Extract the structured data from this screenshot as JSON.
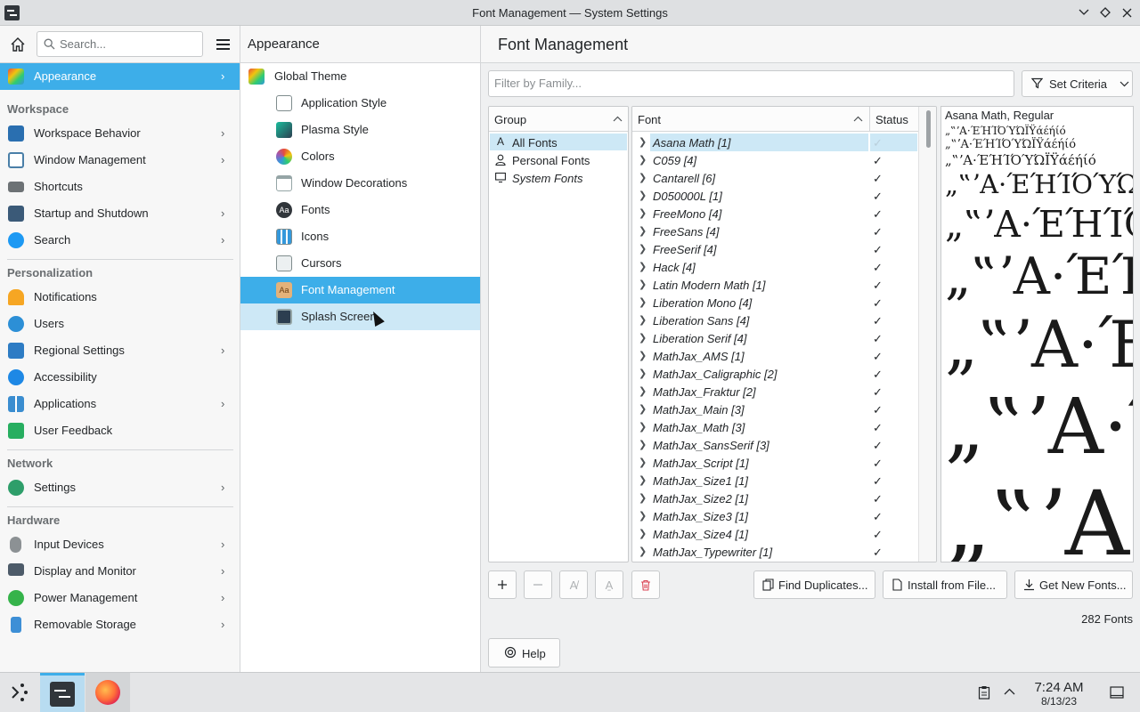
{
  "window": {
    "title": "Font Management — System Settings"
  },
  "sidebar": {
    "search_placeholder": "Search...",
    "selected": {
      "label": "Appearance"
    },
    "sections": {
      "workspace": "Workspace",
      "personalization": "Personalization",
      "network": "Network",
      "hardware": "Hardware"
    },
    "items": [
      {
        "label": "Workspace Behavior",
        "chevron": true,
        "color": "#2a6fb0"
      },
      {
        "label": "Window Management",
        "chevron": true,
        "color": "#4a7fa8"
      },
      {
        "label": "Shortcuts",
        "chevron": false,
        "color": "#6d7275"
      },
      {
        "label": "Startup and Shutdown",
        "chevron": true,
        "color": "#3b5a78"
      },
      {
        "label": "Search",
        "chevron": true,
        "color": "#1d99f3"
      },
      {
        "label": "Notifications",
        "chevron": false,
        "color": "#f6a623"
      },
      {
        "label": "Users",
        "chevron": false,
        "color": "#2c8fd6"
      },
      {
        "label": "Regional Settings",
        "chevron": true,
        "color": "#2d7cc4"
      },
      {
        "label": "Accessibility",
        "chevron": false,
        "color": "#1e88e5"
      },
      {
        "label": "Applications",
        "chevron": true,
        "color": "#3a8dd0"
      },
      {
        "label": "User Feedback",
        "chevron": false,
        "color": "#27ae60"
      },
      {
        "label": "Settings",
        "chevron": true,
        "color": "#2e9e6a"
      },
      {
        "label": "Input Devices",
        "chevron": true,
        "color": "#8c9194"
      },
      {
        "label": "Display and Monitor",
        "chevron": true,
        "color": "#4d5b69"
      },
      {
        "label": "Power Management",
        "chevron": true,
        "color": "#35b34a"
      },
      {
        "label": "Removable Storage",
        "chevron": true,
        "color": "#3d8fd6"
      }
    ]
  },
  "middle": {
    "title": "Appearance",
    "items": [
      {
        "label": "Global Theme"
      },
      {
        "label": "Application Style"
      },
      {
        "label": "Plasma Style"
      },
      {
        "label": "Colors"
      },
      {
        "label": "Window Decorations"
      },
      {
        "label": "Fonts"
      },
      {
        "label": "Icons"
      },
      {
        "label": "Cursors"
      },
      {
        "label": "Font Management"
      },
      {
        "label": "Splash Screen"
      }
    ]
  },
  "main": {
    "title": "Font Management",
    "filter_placeholder": "Filter by Family...",
    "criteria_label": "Set Criteria",
    "group_header": "Group",
    "groups": [
      {
        "label": "All Fonts"
      },
      {
        "label": "Personal Fonts"
      },
      {
        "label": "System Fonts"
      }
    ],
    "font_header": "Font",
    "status_header": "Status",
    "fonts": [
      {
        "name": "Asana Math [1]"
      },
      {
        "name": "C059 [4]"
      },
      {
        "name": "Cantarell [6]"
      },
      {
        "name": "D050000L [1]"
      },
      {
        "name": "FreeMono [4]"
      },
      {
        "name": "FreeSans [4]"
      },
      {
        "name": "FreeSerif [4]"
      },
      {
        "name": "Hack [4]"
      },
      {
        "name": "Latin Modern Math [1]"
      },
      {
        "name": "Liberation Mono [4]"
      },
      {
        "name": "Liberation Sans [4]"
      },
      {
        "name": "Liberation Serif [4]"
      },
      {
        "name": "MathJax_AMS [1]"
      },
      {
        "name": "MathJax_Caligraphic [2]"
      },
      {
        "name": "MathJax_Fraktur [2]"
      },
      {
        "name": "MathJax_Main [3]"
      },
      {
        "name": "MathJax_Math [3]"
      },
      {
        "name": "MathJax_SansSerif [3]"
      },
      {
        "name": "MathJax_Script [1]"
      },
      {
        "name": "MathJax_Size1 [1]"
      },
      {
        "name": "MathJax_Size2 [1]"
      },
      {
        "name": "MathJax_Size3 [1]"
      },
      {
        "name": "MathJax_Size4 [1]"
      },
      {
        "name": "MathJax_Typewriter [1]"
      }
    ],
    "preview_title": "Asana Math, Regular",
    "preview_sample": "„‟ʼA·ΈΉΊΌΎΏΪΫάέήίό",
    "find_duplicates": "Find Duplicates...",
    "install_from_file": "Install from File...",
    "get_new_fonts": "Get New Fonts...",
    "font_count": "282 Fonts",
    "help": "Help"
  },
  "taskbar": {
    "time": "7:24 AM",
    "date": "8/13/23"
  },
  "colors": {
    "accent": "#3daee9",
    "selection_light": "#cde8f6"
  }
}
